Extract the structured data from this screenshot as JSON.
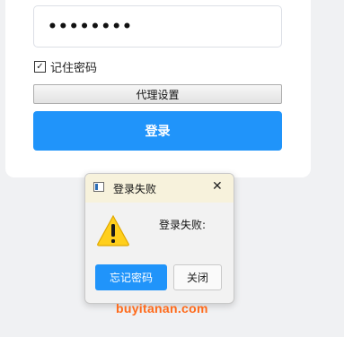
{
  "login": {
    "password_value": "••••••••",
    "remember_label": "记住密码",
    "remember_checked": true,
    "remember_check_glyph": "✓",
    "proxy_button_label": "代理设置",
    "login_button_label": "登录"
  },
  "dialog": {
    "title": "登录失败",
    "close_glyph": "✕",
    "message": "登录失败:",
    "icon": "warning-icon",
    "forget_button_label": "忘记密码",
    "close_button_label": "关闭"
  },
  "watermark": {
    "text": "buyitanan.com"
  },
  "colors": {
    "accent": "#2094fa",
    "watermark": "#ff6a1a",
    "dialog_titlebar": "#f7f2dc",
    "warning_fill": "#ffcf1c"
  }
}
